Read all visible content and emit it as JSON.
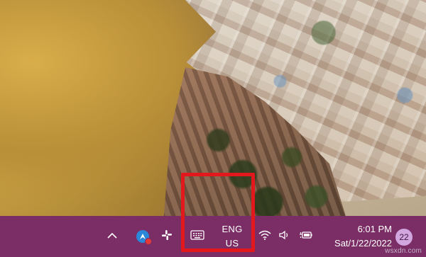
{
  "wallpaper": {
    "description_icon": "landscape-wallpaper"
  },
  "taskbar": {
    "background": "#7b2d66",
    "tray": {
      "overflow_icon": "chevron-up-icon",
      "apps": [
        {
          "name": "app-rocket-icon",
          "color": "#2b88d8",
          "has_badge": true
        },
        {
          "name": "slack-icon"
        }
      ],
      "touch_keyboard_icon": "keyboard-icon",
      "language": {
        "line1": "ENG",
        "line2": "US"
      },
      "wifi_icon": "wifi-icon",
      "volume_icon": "speaker-icon",
      "battery_icon": "battery-charging-icon"
    },
    "clock": {
      "time": "6:01 PM",
      "date": "Sat/1/22/2022"
    },
    "notifications": {
      "count": "22",
      "color": "#d2a7e0"
    }
  },
  "annotation": {
    "highlight_color": "#e3181c",
    "target": "language-indicator"
  },
  "watermark": {
    "text": "wsxdn.com"
  }
}
